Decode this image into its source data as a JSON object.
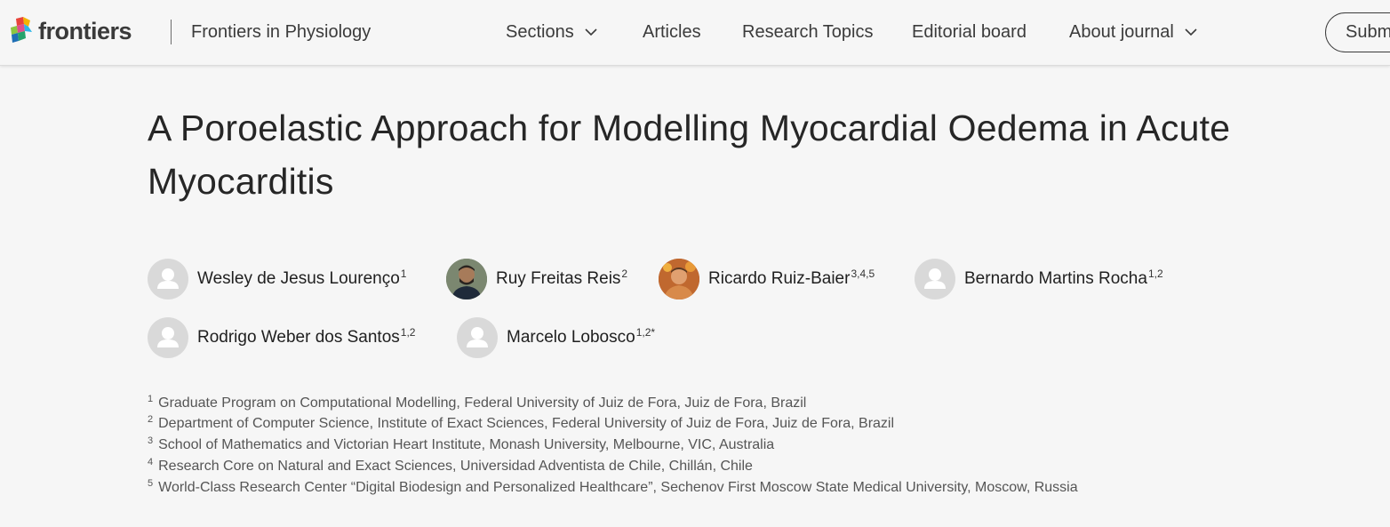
{
  "header": {
    "logo_text": "frontiers",
    "journal": "Frontiers in Physiology",
    "nav": {
      "sections": "Sections",
      "articles": "Articles",
      "research_topics": "Research Topics",
      "editorial_board": "Editorial board",
      "about_journal": "About journal"
    },
    "submit_label": "Subm"
  },
  "article": {
    "title_line1": "A Poroelastic Approach for Modelling Myocardial Oedema in Acute",
    "title_line2": "Myocarditis"
  },
  "authors": [
    {
      "name": "Wesley de Jesus Lourenço",
      "sup": "1",
      "avatar": "placeholder"
    },
    {
      "name": "Ruy Freitas Reis",
      "sup": "2",
      "avatar": "photo"
    },
    {
      "name": "Ricardo Ruiz-Baier",
      "sup": "3,4,5",
      "avatar": "photo"
    },
    {
      "name": "Bernardo Martins Rocha",
      "sup": "1,2",
      "avatar": "placeholder"
    },
    {
      "name": "Rodrigo Weber dos Santos",
      "sup": "1,2",
      "avatar": "placeholder"
    },
    {
      "name": "Marcelo Lobosco",
      "sup": "1,2*",
      "avatar": "placeholder"
    }
  ],
  "affiliations": [
    {
      "num": "1",
      "text": "Graduate Program on Computational Modelling, Federal University of Juiz de Fora, Juiz de Fora, Brazil"
    },
    {
      "num": "2",
      "text": "Department of Computer Science, Institute of Exact Sciences, Federal University of Juiz de Fora, Juiz de Fora, Brazil"
    },
    {
      "num": "3",
      "text": "School of Mathematics and Victorian Heart Institute, Monash University, Melbourne, VIC, Australia"
    },
    {
      "num": "4",
      "text": "Research Core on Natural and Exact Sciences, Universidad Adventista de Chile, Chillán, Chile"
    },
    {
      "num": "5",
      "text": "World-Class Research Center “Digital Biodesign and Personalized Healthcare”, Sechenov First Moscow State Medical University, Moscow, Russia"
    }
  ],
  "colors": {
    "background": "#f6f6f6",
    "text": "#1f1f1f",
    "avatar_placeholder": "#d9d9d9"
  },
  "icons": {
    "sections_dropdown": "chevron-down-icon",
    "about_dropdown": "chevron-down-icon",
    "logo": "frontiers-logo-icon",
    "avatar_placeholder": "user-icon"
  }
}
